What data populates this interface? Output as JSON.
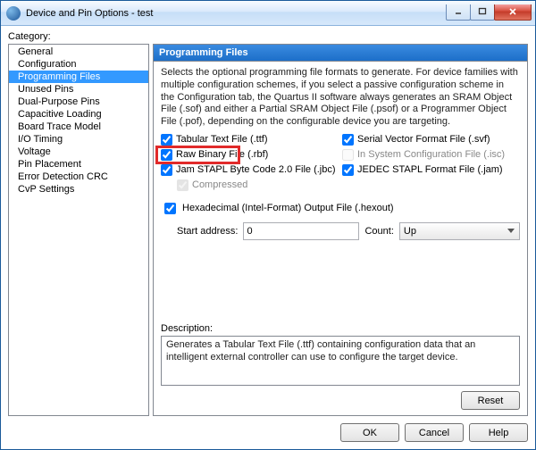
{
  "window": {
    "title": "Device and Pin Options - test"
  },
  "category_label": "Category:",
  "categories": [
    "General",
    "Configuration",
    "Programming Files",
    "Unused Pins",
    "Dual-Purpose Pins",
    "Capacitive Loading",
    "Board Trace Model",
    "I/O Timing",
    "Voltage",
    "Pin Placement",
    "Error Detection CRC",
    "CvP Settings"
  ],
  "selected_category_index": 2,
  "panel": {
    "title": "Programming Files",
    "intro": "Selects the optional programming file formats to generate. For device families with multiple configuration schemes, if you select a passive configuration scheme in the Configuration tab, the Quartus II software always generates an SRAM Object File (.sof) and either a Partial SRAM Object File (.psof) or a Programmer Object File (.pof), depending on the configurable device you are targeting."
  },
  "checks": {
    "ttf": {
      "label": "Tabular Text File (.ttf)",
      "checked": true
    },
    "rbf": {
      "label": "Raw Binary File (.rbf)",
      "checked": true
    },
    "jbc": {
      "label": "Jam STAPL Byte Code 2.0 File (.jbc)",
      "checked": true
    },
    "comp": {
      "label": "Compressed",
      "checked": true,
      "disabled": true
    },
    "svf": {
      "label": "Serial Vector Format File (.svf)",
      "checked": true
    },
    "isc": {
      "label": "In System Configuration File (.isc)",
      "checked": false,
      "disabled": true
    },
    "jam": {
      "label": "JEDEC STAPL Format File (.jam)",
      "checked": true
    },
    "hexout": {
      "label": "Hexadecimal (Intel-Format) Output File (.hexout)",
      "checked": true
    }
  },
  "addr": {
    "start_label": "Start address:",
    "start_value": "0",
    "count_label": "Count:",
    "count_value": "Up"
  },
  "description": {
    "label": "Description:",
    "text": "Generates a Tabular Text File (.ttf) containing configuration data that an intelligent external controller can use to configure the target device."
  },
  "buttons": {
    "reset": "Reset",
    "ok": "OK",
    "cancel": "Cancel",
    "help": "Help"
  }
}
